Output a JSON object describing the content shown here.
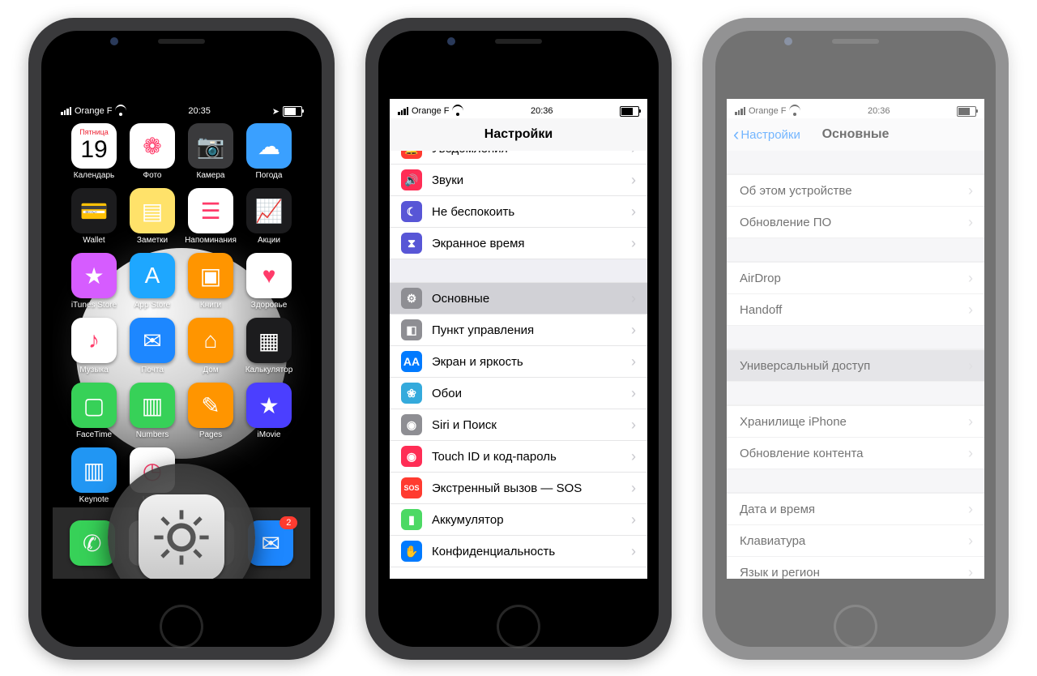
{
  "phone1": {
    "status": {
      "carrier": "Orange F",
      "time": "20:35"
    },
    "apps": {
      "row1": [
        {
          "label": "Календарь",
          "special": "calendar",
          "day_word": "Пятница",
          "day_num": "19"
        },
        {
          "label": "Фото",
          "color": "#fff"
        },
        {
          "label": "Камера",
          "color": "#3a3a3c"
        },
        {
          "label": "Погода",
          "color": "#3aa0ff"
        }
      ],
      "row2": [
        {
          "label": "Wallet",
          "color": "#1c1c1e"
        },
        {
          "label": "Заметки",
          "color": "#ffe26a"
        },
        {
          "label": "Напоминания",
          "color": "#fff"
        },
        {
          "label": "Акции",
          "color": "#1c1c1e"
        }
      ],
      "row3": [
        {
          "label": "iTunes Store",
          "color": "#d65cff"
        },
        {
          "label": "App Store",
          "color": "#1ea7ff"
        },
        {
          "label": "Книги",
          "color": "#ff9500"
        },
        {
          "label": "Здоровье",
          "color": "#fff"
        }
      ],
      "row4": [
        {
          "label": "Музыка",
          "color": "#fff"
        },
        {
          "label": "Почта",
          "color": "#1d87ff"
        },
        {
          "label": "Дом",
          "color": "#ff9500"
        },
        {
          "label": "Калькулятор",
          "color": "#1c1c1e"
        }
      ],
      "row5": [
        {
          "label": "FaceTime",
          "color": "#37d158"
        },
        {
          "label": "Numbers",
          "color": "#37d158"
        },
        {
          "label": "Pages",
          "color": "#ff9500"
        },
        {
          "label": "iMovie",
          "color": "#4b3fff"
        }
      ],
      "row6": [
        {
          "label": "Keynote",
          "color": "#2196f3"
        },
        {
          "label": "Часы",
          "color": "#fff"
        }
      ]
    },
    "dock_badge": "2"
  },
  "phone2": {
    "status": {
      "carrier": "Orange F",
      "time": "20:36"
    },
    "title": "Настройки",
    "rows": [
      {
        "icon_bg": "bg-red",
        "glyph": "🔔",
        "label": "Уведомления"
      },
      {
        "icon_bg": "bg-pink",
        "glyph": "🔊",
        "label": "Звуки"
      },
      {
        "icon_bg": "bg-purple",
        "glyph": "☾",
        "label": "Не беспокоить"
      },
      {
        "icon_bg": "bg-purple",
        "glyph": "⧗",
        "label": "Экранное время"
      },
      {
        "gap": true
      },
      {
        "icon_bg": "bg-grey",
        "glyph": "⚙",
        "label": "Основные",
        "selected": true
      },
      {
        "icon_bg": "bg-grey",
        "glyph": "◧",
        "label": "Пункт управления"
      },
      {
        "icon_bg": "bg-blue",
        "glyph": "AA",
        "label": "Экран и яркость"
      },
      {
        "icon_bg": "bg-dblue",
        "glyph": "❀",
        "label": "Обои"
      },
      {
        "icon_bg": "bg-grey",
        "glyph": "◉",
        "label": "Siri и Поиск"
      },
      {
        "icon_bg": "bg-pink",
        "glyph": "◉",
        "label": "Touch ID и код-пароль"
      },
      {
        "icon_bg": "bg-red",
        "glyph": "SOS",
        "label": "Экстренный вызов — SOS"
      },
      {
        "icon_bg": "bg-green",
        "glyph": "▮",
        "label": "Аккумулятор"
      },
      {
        "icon_bg": "bg-blue",
        "glyph": "✋",
        "label": "Конфиденциальность"
      }
    ]
  },
  "phone3": {
    "status": {
      "carrier": "Orange F",
      "time": "20:36"
    },
    "back": "Настройки",
    "title": "Основные",
    "groups": [
      [
        "Об этом устройстве",
        "Обновление ПО"
      ],
      [
        "AirDrop",
        "Handoff"
      ],
      [
        "Универсальный доступ"
      ],
      [
        "Хранилище iPhone",
        "Обновление контента"
      ],
      [
        "Дата и время",
        "Клавиатура",
        "Язык и регион"
      ]
    ],
    "selected": "Универсальный доступ"
  }
}
